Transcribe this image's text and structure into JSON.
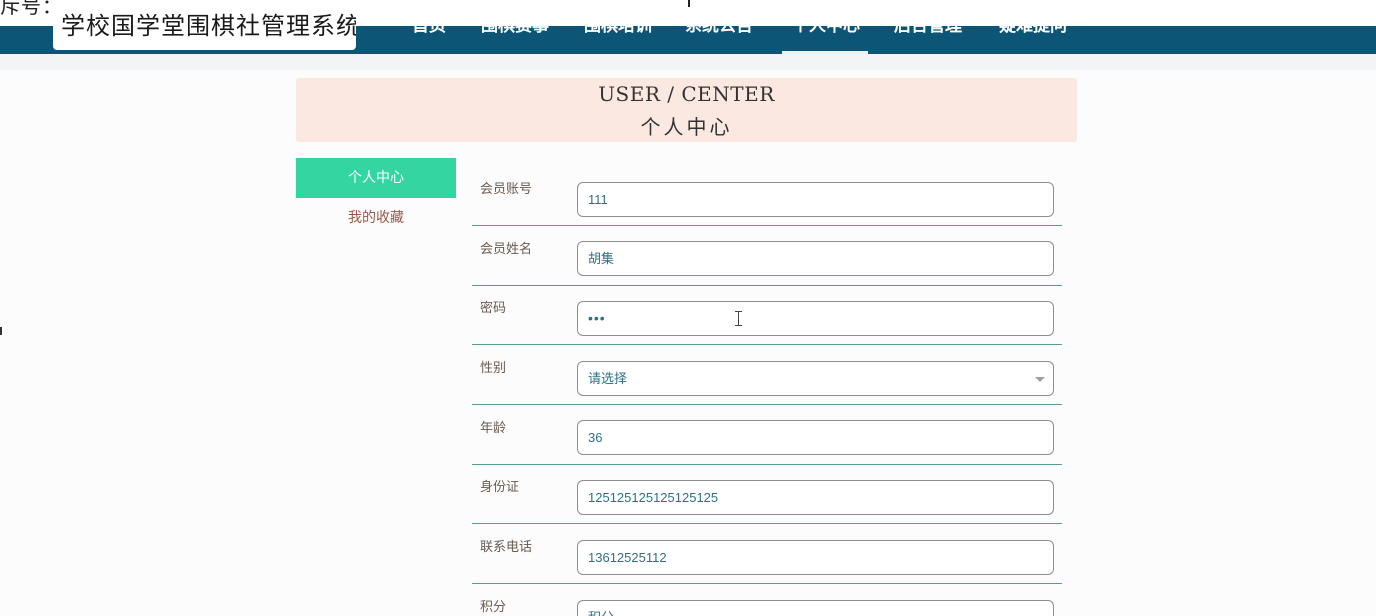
{
  "top_strip_text": "斥号：",
  "brand_title": "学校国学堂围棋社管理系统",
  "nav": [
    "首页",
    "围棋赛事",
    "围棋培训",
    "系统公告",
    "个人中心",
    "后台管理",
    "疑难提问"
  ],
  "nav_active": "个人中心",
  "hero": {
    "title_en": "USER / CENTER",
    "title_cn": "个人中心"
  },
  "sidebar": {
    "active": "个人中心",
    "link": "我的收藏"
  },
  "form": {
    "fields": [
      {
        "label": "会员账号",
        "value": "111"
      },
      {
        "label": "会员姓名",
        "value": "胡集"
      },
      {
        "label": "密码",
        "value": "•••"
      },
      {
        "label": "性别",
        "value": "请选择"
      },
      {
        "label": "年龄",
        "value": "36"
      },
      {
        "label": "身份证",
        "value": "125125125125125125"
      },
      {
        "label": "联系电话",
        "value": "13612525112"
      },
      {
        "label": "积分",
        "value": "积分"
      }
    ]
  },
  "colors": {
    "navbar": "#0d5577",
    "accent_green": "#33d6a1",
    "hero_bg": "#fbe8e1",
    "row_divider": "#5a9e92"
  }
}
